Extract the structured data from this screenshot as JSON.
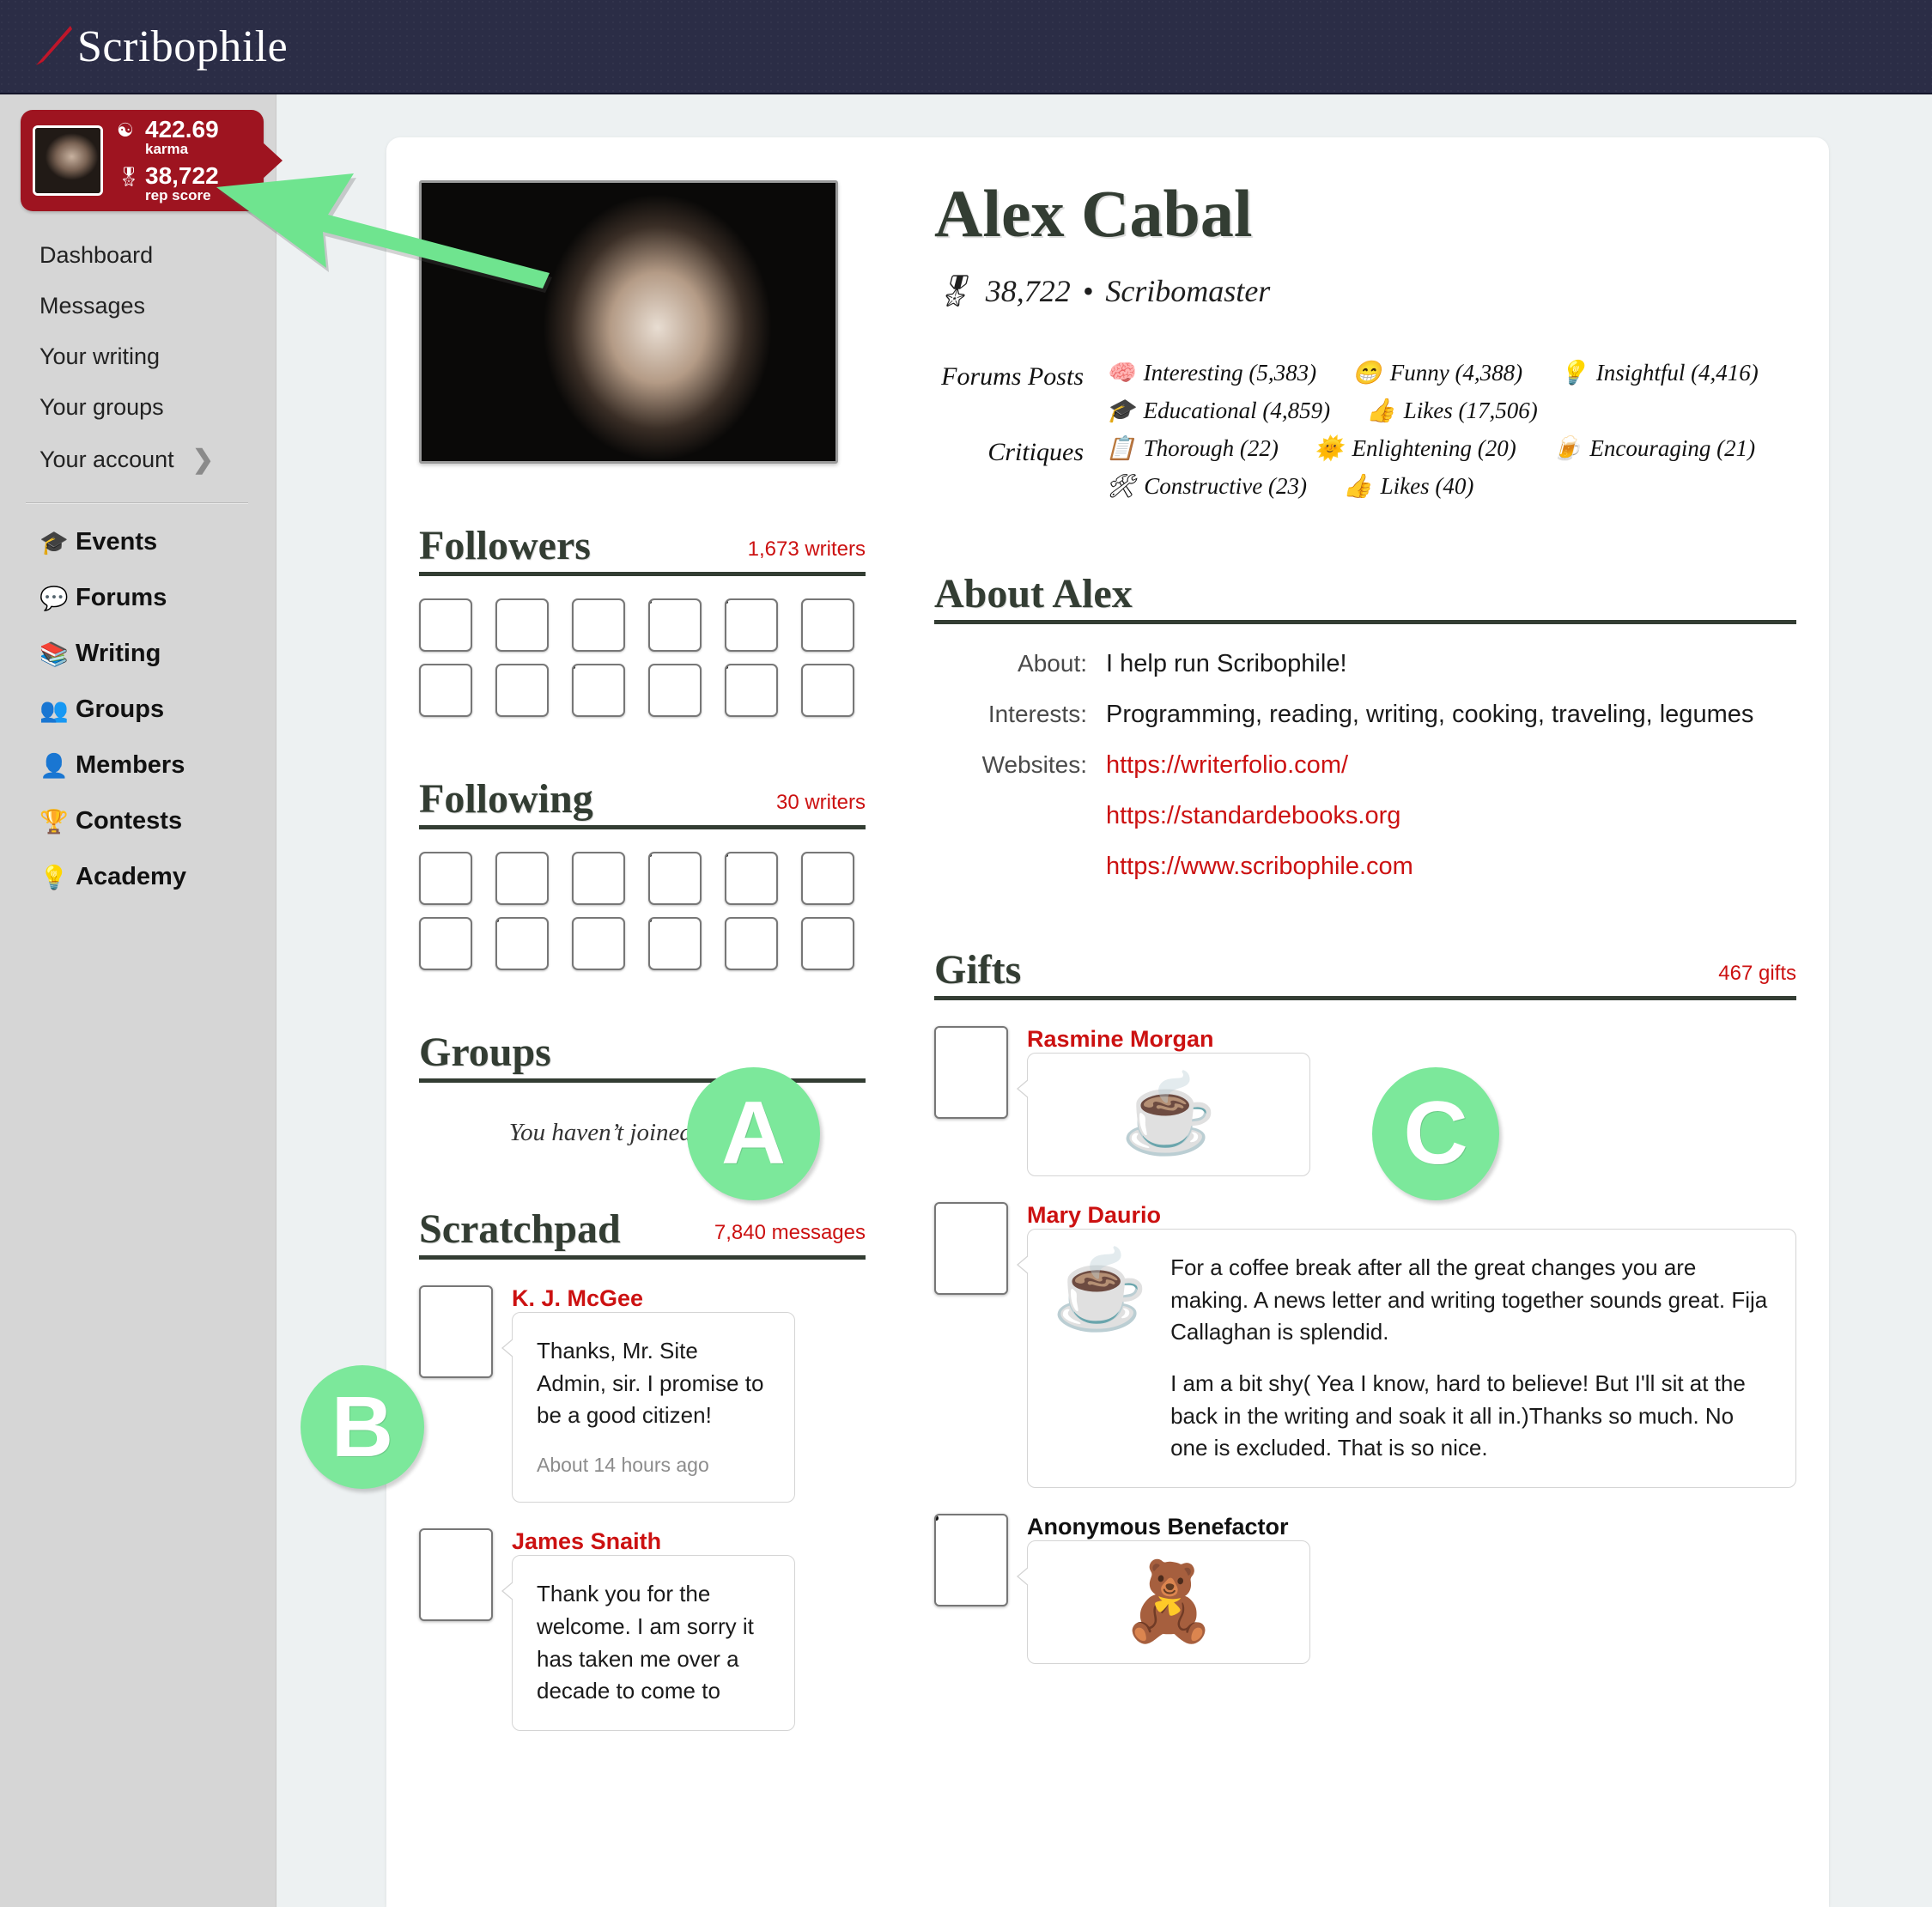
{
  "header": {
    "logo_text": "Scribophile",
    "logo_icon": "quill-slash-icon"
  },
  "sidebar": {
    "badge": {
      "karma_icon": "yin-yang-icon",
      "karma_value": "422.69",
      "karma_label": "karma",
      "rep_icon": "rosette-icon",
      "rep_value": "38,722",
      "rep_label": "rep score",
      "avatar": "user-avatar"
    },
    "nav_top": [
      {
        "label": "Dashboard",
        "chevron": ""
      },
      {
        "label": "Messages",
        "chevron": ""
      },
      {
        "label": "Your writing",
        "chevron": ""
      },
      {
        "label": "Your groups",
        "chevron": ""
      },
      {
        "label": "Your account",
        "chevron": "❯"
      }
    ],
    "nav_main": [
      {
        "label": "Events",
        "icon": "🎓"
      },
      {
        "label": "Forums",
        "icon": "💬"
      },
      {
        "label": "Writing",
        "icon": "📚"
      },
      {
        "label": "Groups",
        "icon": "👥"
      },
      {
        "label": "Members",
        "icon": "👤"
      },
      {
        "label": "Contests",
        "icon": "🏆"
      },
      {
        "label": "Academy",
        "icon": "💡"
      }
    ]
  },
  "profile": {
    "name": "Alex Cabal",
    "rank_icon": "🎖",
    "rank_score": "38,722",
    "rank_separator": "•",
    "rank_title": "Scribomaster",
    "photo": "profile-photo"
  },
  "stats": {
    "forums_label": "Forums Posts",
    "forums_rows": [
      [
        {
          "icon": "🧠",
          "label": "Interesting (5,383)"
        },
        {
          "icon": "😁",
          "label": "Funny (4,388)"
        },
        {
          "icon": "💡",
          "label": "Insightful (4,416)"
        }
      ],
      [
        {
          "icon": "🎓",
          "label": "Educational (4,859)"
        },
        {
          "icon": "👍",
          "label": "Likes (17,506)"
        }
      ]
    ],
    "critiques_label": "Critiques",
    "critiques_rows": [
      [
        {
          "icon": "📋",
          "label": "Thorough (22)"
        },
        {
          "icon": "🌞",
          "label": "Enlightening (20)"
        },
        {
          "icon": "🍺",
          "label": "Encouraging (21)"
        }
      ],
      [
        {
          "icon": "🛠",
          "label": "Constructive (23)"
        },
        {
          "icon": "👍",
          "label": "Likes (40)"
        }
      ]
    ]
  },
  "about": {
    "title": "About Alex",
    "rows": [
      {
        "key": "About:",
        "value": "I help run Scribophile!"
      },
      {
        "key": "Interests:",
        "value": "Programming, reading, writing, cooking, traveling, legumes"
      }
    ],
    "websites_key": "Websites:",
    "websites": [
      "https://writerfolio.com/",
      "https://standardebooks.org",
      "https://www.scribophile.com"
    ]
  },
  "followers": {
    "title": "Followers",
    "count": "1,673 writers",
    "avatars": [
      {
        "blank": false,
        "style": "g1"
      },
      {
        "blank": false,
        "style": "g2"
      },
      {
        "blank": false,
        "style": "g3"
      },
      {
        "blank": true,
        "style": ""
      },
      {
        "blank": true,
        "style": ""
      },
      {
        "blank": false,
        "style": "g6"
      },
      {
        "blank": false,
        "style": "g7"
      },
      {
        "blank": false,
        "style": "g8"
      },
      {
        "blank": true,
        "style": ""
      },
      {
        "blank": false,
        "style": "g10"
      },
      {
        "blank": true,
        "style": ""
      },
      {
        "blank": false,
        "style": "g12"
      }
    ]
  },
  "following": {
    "title": "Following",
    "count": "30 writers",
    "avatars": [
      {
        "blank": false,
        "style": "f1"
      },
      {
        "blank": false,
        "style": "f2"
      },
      {
        "blank": false,
        "style": "f3"
      },
      {
        "blank": true,
        "style": ""
      },
      {
        "blank": true,
        "style": ""
      },
      {
        "blank": false,
        "style": "f6"
      },
      {
        "blank": false,
        "style": "f7"
      },
      {
        "blank": true,
        "style": ""
      },
      {
        "blank": false,
        "style": "f9"
      },
      {
        "blank": true,
        "style": ""
      },
      {
        "blank": false,
        "style": "f11"
      },
      {
        "blank": false,
        "style": "f12"
      }
    ]
  },
  "groups": {
    "title": "Groups",
    "empty_text": "You haven’t joined any yet."
  },
  "scratchpad": {
    "title": "Scratchpad",
    "count": "7,840 messages",
    "messages": [
      {
        "name": "K. J. McGee",
        "avatar": "rocket-launch-avatar",
        "text": "Thanks, Mr. Site Admin, sir. I promise to be a good citizen!",
        "timestamp": "About 14 hours ago"
      },
      {
        "name": "James Snaith",
        "avatar": "man-glasses-avatar",
        "text": "Thank you for the welcome. I am sorry it has taken me over a decade to come to"
      }
    ]
  },
  "gifts": {
    "title": "Gifts",
    "count": "467 gifts",
    "items": [
      {
        "name": "Rasmine Morgan",
        "avatar": "grayscale-avatar",
        "gift_icon": "☕",
        "message": ""
      },
      {
        "name": "Mary Daurio",
        "avatar": "horse-rider-avatar",
        "gift_icon": "☕",
        "message_p1": "For a coffee break after all the great changes you are making. A news letter and writing together sounds great. Fija Callaghan is splendid.",
        "message_p2": "I am a bit shy( Yea I know, hard to believe! But I'll sit at the back in the writing and soak it all in.)Thanks so much. No one is excluded. That is so nice."
      },
      {
        "name": "Anonymous Benefactor",
        "avatar": "blank-avatar",
        "gift_icon": "🧸",
        "message": ""
      }
    ]
  },
  "annotations": {
    "marker_a": "A",
    "marker_b": "B",
    "marker_c": "C",
    "arrow": "green-arrow-pointing-to-rep-score",
    "color": "#7CE89B"
  }
}
